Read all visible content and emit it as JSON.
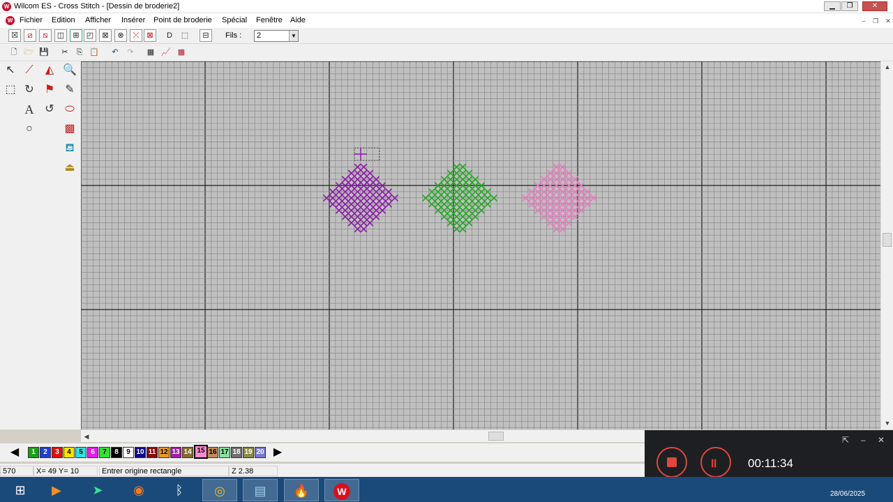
{
  "window": {
    "title": "Wilcom ES - Cross Stitch - [Dessin de broderie2]",
    "logo": "W",
    "controls": {
      "minimize": "▁",
      "maximize": "❐",
      "close": "✕"
    }
  },
  "menu": {
    "items": [
      "Fichier",
      "Edition",
      "Afficher",
      "Insérer",
      "Point de broderie",
      "Spécial",
      "Fenêtre",
      "Aide"
    ],
    "mdi_controls": {
      "minimize": "–",
      "restore": "❐",
      "close": "✕"
    }
  },
  "toolbar1": {
    "buttons": [
      "stitch-full-cross",
      "stitch-half-cross-a",
      "stitch-half-cross-b",
      "stitch-quarter-a",
      "stitch-quarter-b",
      "stitch-quarter-c",
      "stitch-three-quarter-a",
      "stitch-three-quarter-b",
      "stitch-petite",
      "stitch-backstitch",
      "stitch-french-knot",
      "stitch-bead",
      "stitch-outline"
    ],
    "fils_label": "Fils :",
    "fils_value": "2"
  },
  "toolbar2": {
    "buttons": [
      "new-file",
      "open-file",
      "save-file",
      "cut",
      "copy",
      "paste",
      "undo",
      "redo",
      "grid",
      "chart",
      "pattern"
    ]
  },
  "toolbox": {
    "tools": [
      "select",
      "needle",
      "mirror",
      "zoom",
      "lasso-select",
      "rotate",
      "flag",
      "pencil",
      "text",
      "loop",
      "eraser",
      "circle",
      "fill-pattern",
      "paint-bucket",
      "stamp"
    ]
  },
  "palette": {
    "swatches": [
      {
        "label": "1",
        "color": "#1a9e1a"
      },
      {
        "label": "2",
        "color": "#1f3fd6"
      },
      {
        "label": "3",
        "color": "#e01010"
      },
      {
        "label": "4",
        "color": "#f5e400"
      },
      {
        "label": "5",
        "color": "#2ee0e0"
      },
      {
        "label": "6",
        "color": "#e020e0"
      },
      {
        "label": "7",
        "color": "#36e036"
      },
      {
        "label": "8",
        "color": "#000000"
      },
      {
        "label": "9",
        "color": "#ffffff"
      },
      {
        "label": "10",
        "color": "#0a0a8a"
      },
      {
        "label": "11",
        "color": "#8a0a0a"
      },
      {
        "label": "12",
        "color": "#e89a28"
      },
      {
        "label": "13",
        "color": "#a020a0"
      },
      {
        "label": "14",
        "color": "#8a6a2a"
      },
      {
        "label": "15",
        "color": "#ff8ad0"
      },
      {
        "label": "16",
        "color": "#c08a5a"
      },
      {
        "label": "17",
        "color": "#8ae0a0"
      },
      {
        "label": "18",
        "color": "#707070"
      },
      {
        "label": "19",
        "color": "#8a8a4a"
      },
      {
        "label": "20",
        "color": "#7a7ad0"
      }
    ],
    "selected": "15"
  },
  "status": {
    "count": "570",
    "coords": "X= 49  Y= 10",
    "prompt": "Entrer origine rectangle",
    "zoom": "Z 2.38"
  },
  "recorder": {
    "timer": "00:11:34"
  },
  "taskbar": {
    "apps": [
      "start-button",
      "media-player",
      "app-arrow",
      "firefox",
      "bluetooth",
      "chrome",
      "file-explorer",
      "fire-app",
      "wilcom-app"
    ],
    "date": "28/06/2025"
  },
  "colors": {
    "purple": "#8b1aa8",
    "green": "#22a822",
    "pink": "#e87ac0",
    "grid_minor": "#808080",
    "grid_major": "#202020"
  }
}
